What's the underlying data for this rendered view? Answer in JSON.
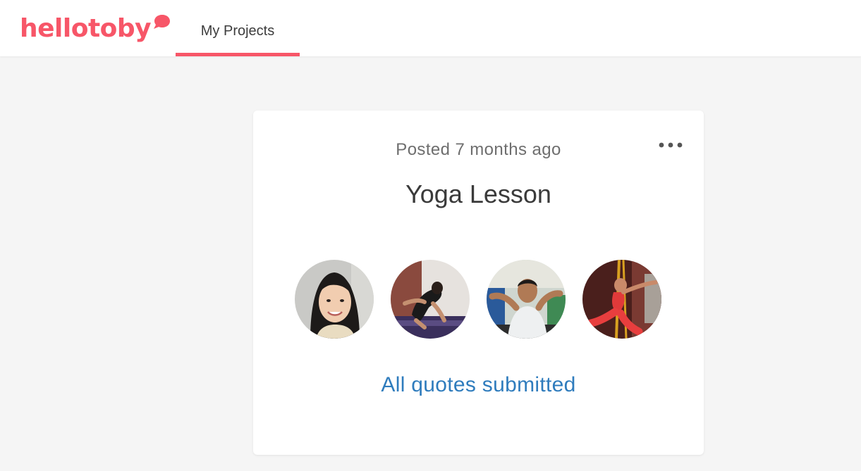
{
  "brand": {
    "name": "hellotoby",
    "color": "#f75668"
  },
  "nav": {
    "tabs": [
      {
        "label": "My Projects",
        "active": true
      }
    ]
  },
  "project_card": {
    "posted": "Posted 7 months ago",
    "title": "Yoga Lesson",
    "menu_icon": "more-horizontal-icon",
    "avatars": [
      {
        "description": "photo of smiling woman with dark hair"
      },
      {
        "description": "photo of person in yoga pose on mat"
      },
      {
        "description": "photo of person doing yoga stretch"
      },
      {
        "description": "photo of person doing aerial yoga in red"
      }
    ],
    "status_link": "All quotes submitted",
    "link_color": "#2f7cbd"
  }
}
